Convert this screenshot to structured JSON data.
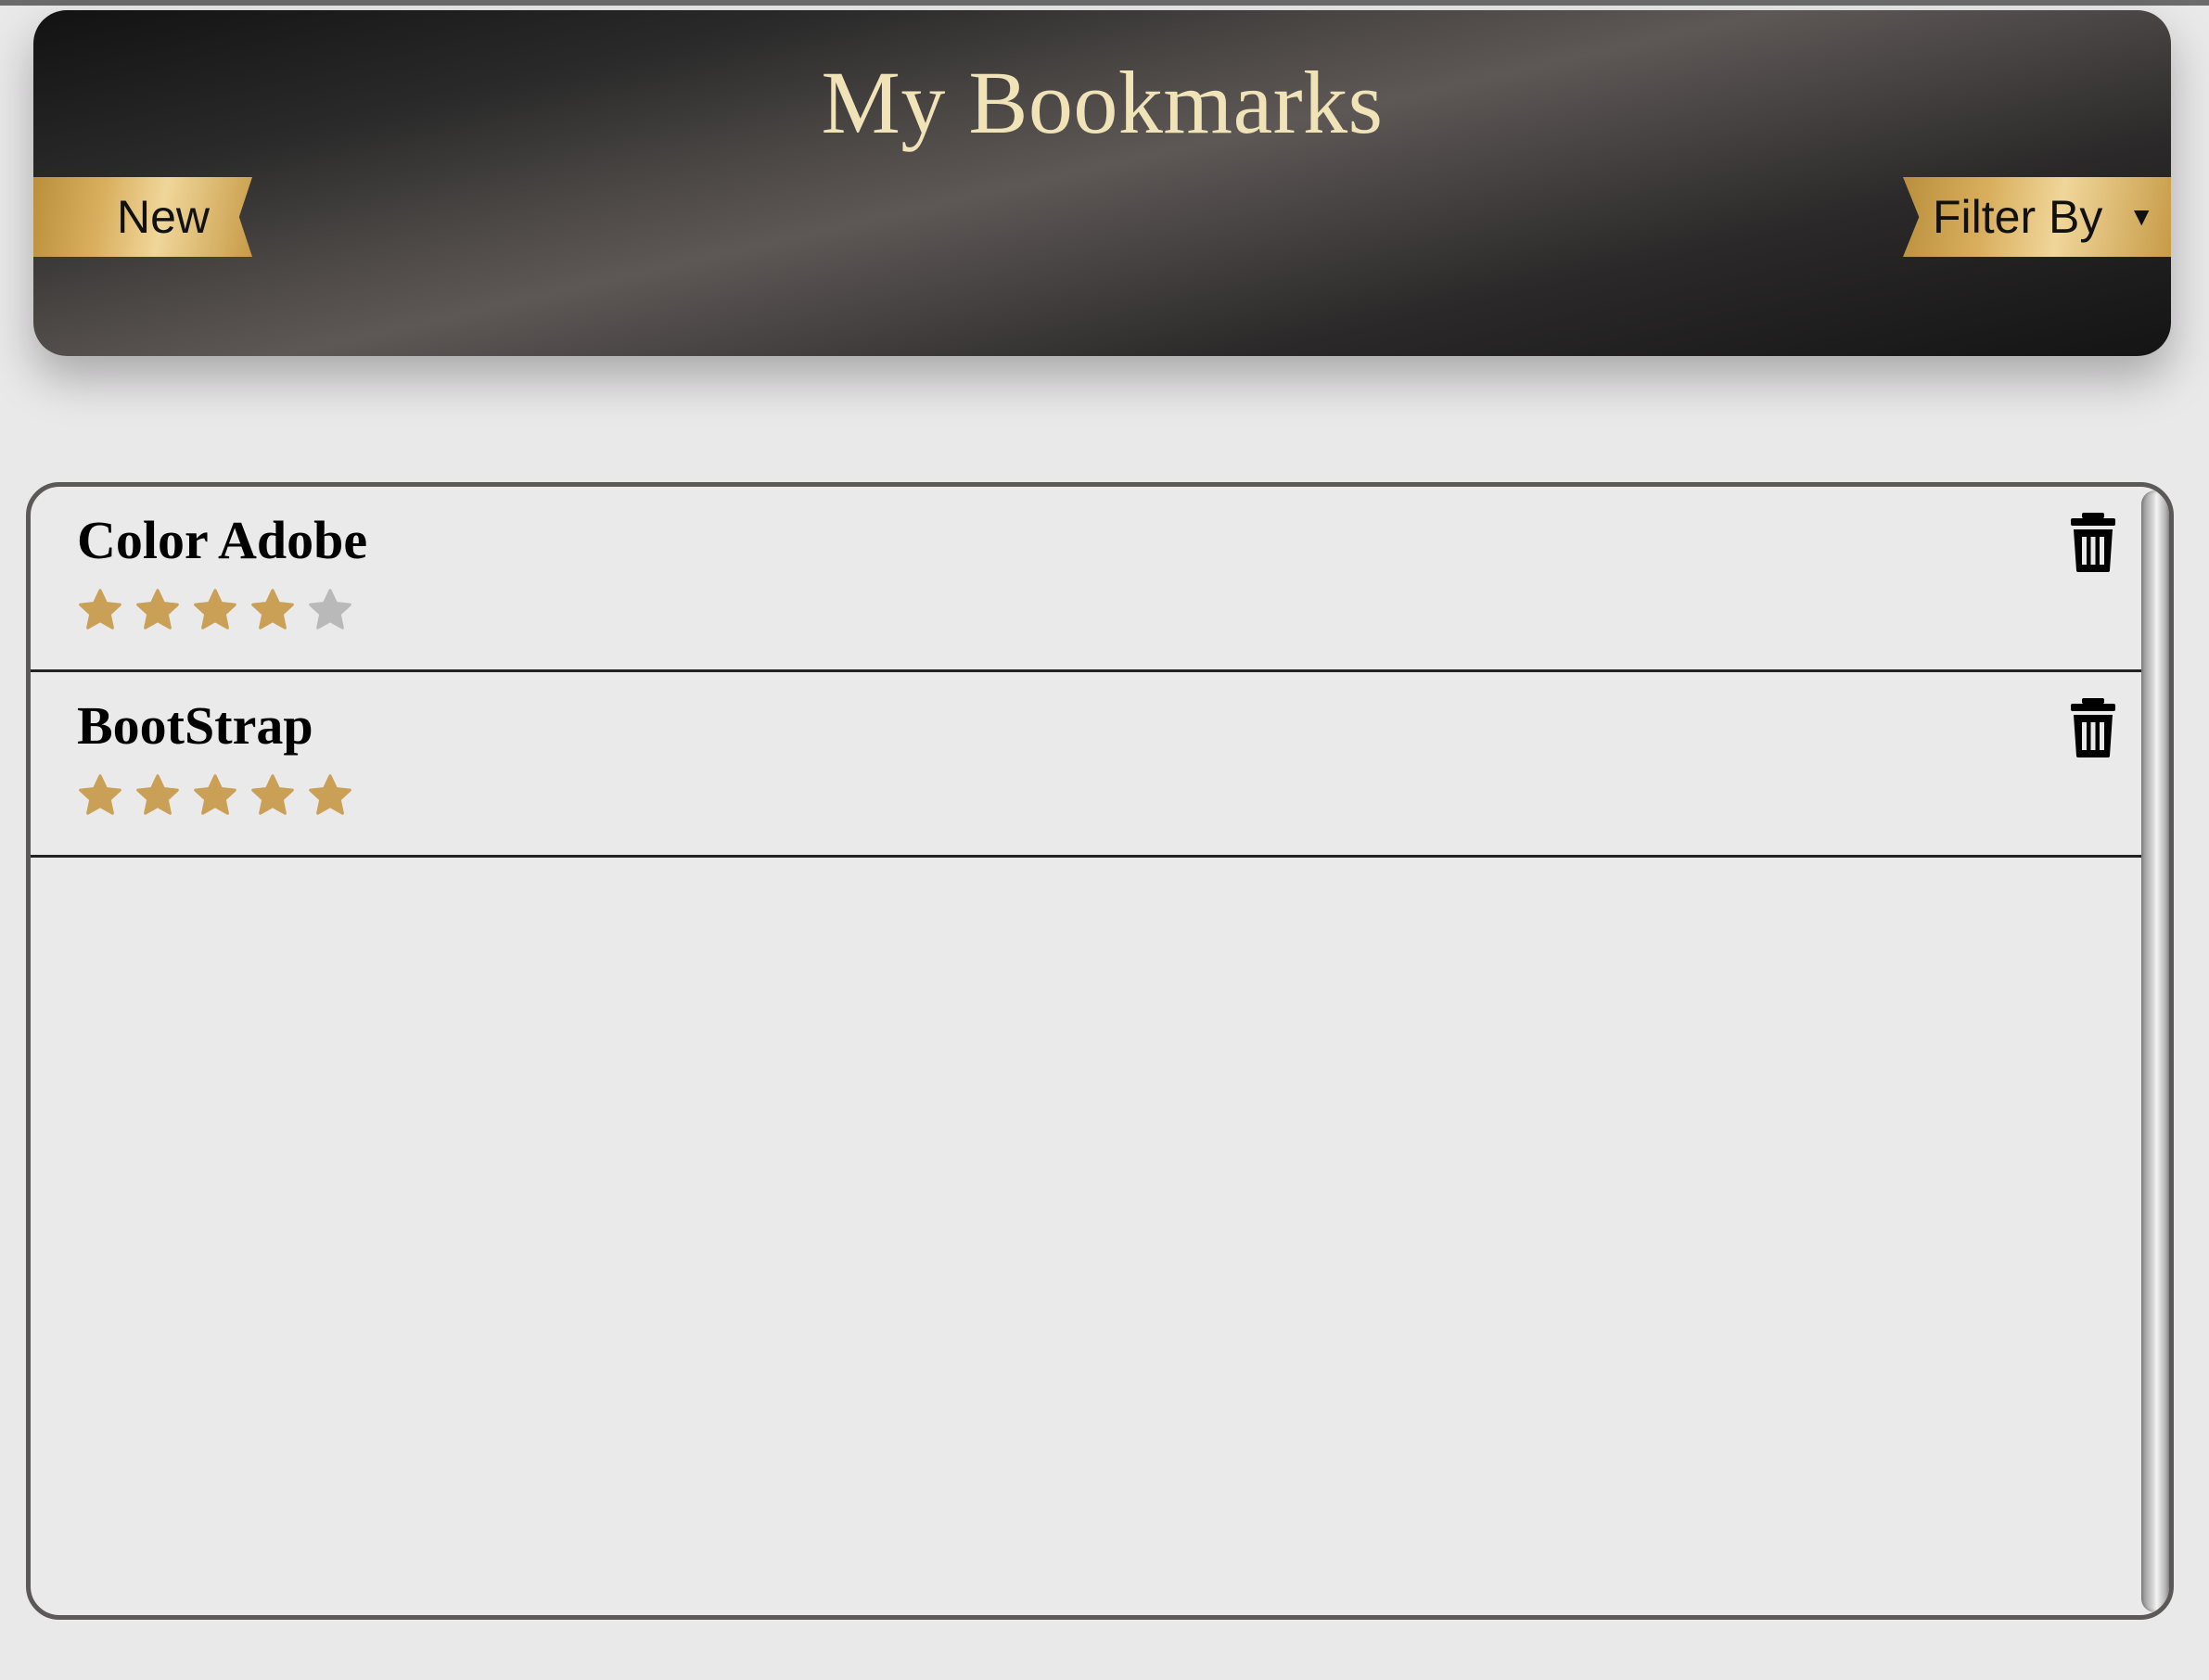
{
  "header": {
    "title": "My Bookmarks",
    "new_label": "New",
    "filter_label": "Filter By",
    "filter_caret": "▼"
  },
  "bookmarks": [
    {
      "name": "Color Adobe",
      "rating": 4,
      "max_rating": 5
    },
    {
      "name": "BootStrap",
      "rating": 5,
      "max_rating": 5
    }
  ],
  "colors": {
    "star_on": "#c9a055",
    "star_off": "#b9b9b9",
    "title": "#f1e3b8"
  },
  "icons": {
    "delete": "trash-icon",
    "rating": "star-icon",
    "dropdown": "caret-down-icon"
  }
}
